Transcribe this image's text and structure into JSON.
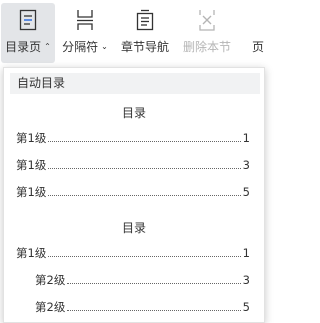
{
  "ribbon": {
    "buttons": [
      {
        "label": "目录页",
        "caret": "⌃",
        "icon": "toc-page-icon"
      },
      {
        "label": "分隔符",
        "caret": "⌄",
        "icon": "separator-icon"
      },
      {
        "label": "章节导航",
        "icon": "chapter-nav-icon"
      },
      {
        "label": "删除本节",
        "icon": "delete-section-icon"
      },
      {
        "label": "页"
      }
    ]
  },
  "panel": {
    "header": "自动目录",
    "preview1": {
      "title": "目录",
      "rows": [
        {
          "label": "第1级",
          "page": "1"
        },
        {
          "label": "第1级",
          "page": "3"
        },
        {
          "label": "第1级",
          "page": "5"
        }
      ]
    },
    "preview2": {
      "title": "目录",
      "rows": [
        {
          "label": "第1级",
          "page": "1"
        },
        {
          "label": "第2级",
          "page": "3"
        },
        {
          "label": "第2级",
          "page": "5"
        }
      ]
    }
  },
  "colors": {
    "active_bg": "#e3e5e8",
    "disabled_text": "#b5b5b5",
    "panel_header_bg": "#f1f2f3"
  }
}
